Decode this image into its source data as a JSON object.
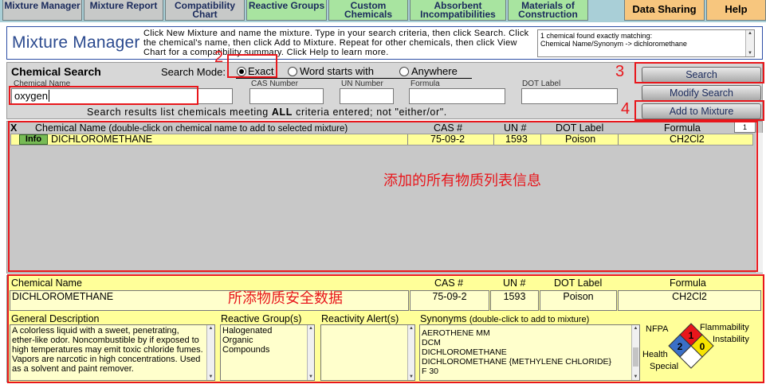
{
  "tabs": [
    {
      "label": "Mixture Manager"
    },
    {
      "label": "Mixture Report"
    },
    {
      "label": "Compatibility Chart"
    },
    {
      "label": "Reactive Groups"
    },
    {
      "label": "Custom Chemicals"
    },
    {
      "label": "Absorbent Incompatibilities"
    },
    {
      "label": "Materials of Construction"
    },
    {
      "label": "Data Sharing"
    },
    {
      "label": "Help"
    }
  ],
  "header": {
    "title": "Mixture Manager",
    "instructions": "Click New Mixture and name the mixture. Type in your search criteria, then click Search. Click the chemical's name, then click Add to Mixture. Repeat for other chemicals, then click View Chart for a compatibility summary. Click Help to learn more.",
    "found_line1": "1 chemical found exactly matching:",
    "found_line2": "Chemical Name/Synonym -> dichloromethane"
  },
  "search": {
    "title": "Chemical Search",
    "mode_label": "Search Mode:",
    "modes": [
      "Exact",
      "Word starts with",
      "Anywhere"
    ],
    "selected_mode": "Exact",
    "labels": {
      "chemical_name": "Chemical Name",
      "cas": "CAS Number",
      "un": "UN Number",
      "formula": "Formula",
      "dot": "DOT Label"
    },
    "chemical_name_value": "oxygen",
    "cas_value": "",
    "un_value": "",
    "formula_value": "",
    "dot_value": "",
    "note_pre": "Search results list chemicals meeting ",
    "note_bold": "ALL",
    "note_post": " criteria entered; not \"either/or\".",
    "btn_search": "Search",
    "btn_modify": "Modify Search",
    "btn_add": "Add to Mixture"
  },
  "results": {
    "headers": {
      "x": "X",
      "name": "Chemical Name",
      "name_hint": "(double-click on chemical name to add to selected mixture)",
      "cas": "CAS #",
      "un": "UN #",
      "dot": "DOT Label",
      "formula": "Formula"
    },
    "count": "1",
    "rows": [
      {
        "badge": "Info",
        "name": "DICHLOROMETHANE",
        "cas": "75-09-2",
        "un": "1593",
        "dot": "Poison",
        "formula": "CH2Cl2"
      }
    ]
  },
  "detail": {
    "labels": {
      "name": "Chemical Name",
      "cas": "CAS #",
      "un": "UN #",
      "dot": "DOT Label",
      "formula": "Formula",
      "general": "General Description",
      "reactive": "Reactive Group(s)",
      "alerts": "Reactivity Alert(s)",
      "synonyms": "Synonyms",
      "synonyms_hint": "(double-click to add to mixture)"
    },
    "name": "DICHLOROMETHANE",
    "cas": "75-09-2",
    "un": "1593",
    "dot": "Poison",
    "formula": "CH2Cl2",
    "general_description": "A colorless liquid with a sweet, penetrating, ether-like odor. Noncombustible by  if exposed to high temperatures may emit toxic chloride fumes. Vapors are narcotic in high concentrations. Used as a solvent and paint remover.",
    "reactive_groups": [
      "Halogenated",
      "Organic",
      "Compounds"
    ],
    "synonyms": [
      "AEROTHENE MM",
      "DCM",
      "DICHLOROMETHANE",
      "DICHLOROMETHANE {METHYLENE CHLORIDE}",
      "F 30"
    ],
    "nfpa": {
      "title": "NFPA",
      "flammability_label": "Flammability",
      "instability_label": "Instability",
      "health_label": "Health",
      "special_label": "Special",
      "flammability": "1",
      "instability": "0",
      "health": "2",
      "special": ""
    }
  },
  "annotations": {
    "n2": "2",
    "n3": "3",
    "n4": "4",
    "list_note": "添加的所有物质列表信息",
    "detail_note": "所添物质安全数据"
  },
  "colors": {
    "tab_gray": "#c7c9c8",
    "tab_green": "#a8e4a0",
    "tab_orange": "#f7c67e",
    "row_yellow": "#ffff99",
    "annotation_red": "#e8161b",
    "nfpa_red": "#e8161b",
    "nfpa_blue": "#3a6fc7",
    "nfpa_yellow": "#f7e400"
  }
}
